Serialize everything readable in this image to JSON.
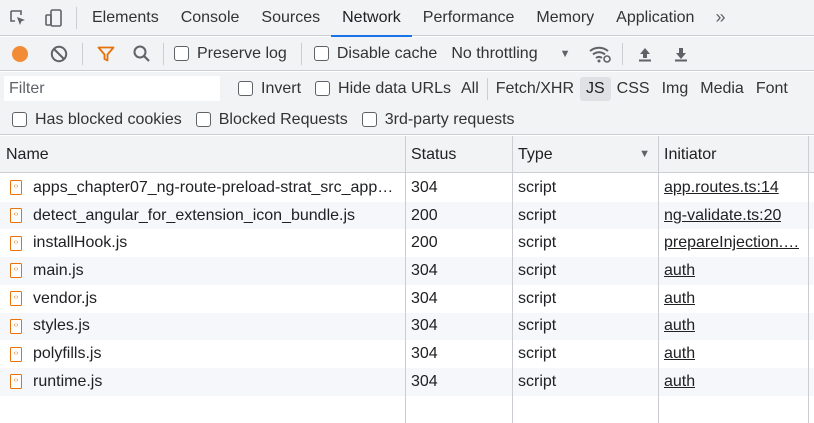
{
  "tabs": {
    "items": [
      "Elements",
      "Console",
      "Sources",
      "Network",
      "Performance",
      "Memory",
      "Application"
    ],
    "active": "Network",
    "more": "»"
  },
  "toolbar": {
    "record_color": "#f28b36",
    "preserve_log": "Preserve log",
    "disable_cache": "Disable cache",
    "throttling": "No throttling",
    "throttling_arrow": "▼"
  },
  "filter": {
    "placeholder": "Filter",
    "invert": "Invert",
    "hide_data_urls": "Hide data URLs",
    "types": [
      "All",
      "Fetch/XHR",
      "JS",
      "CSS",
      "Img",
      "Media",
      "Font"
    ],
    "active_type": "JS",
    "has_blocked_cookies": "Has blocked cookies",
    "blocked_requests": "Blocked Requests",
    "third_party": "3rd-party requests"
  },
  "table": {
    "columns": [
      "Name",
      "Status",
      "Type",
      "Initiator"
    ],
    "sort_arrow": "▼",
    "rows": [
      {
        "name": "apps_chapter07_ng-route-preload-strat_src_app…",
        "status": "304",
        "type": "script",
        "initiator": "app.routes.ts:14"
      },
      {
        "name": "detect_angular_for_extension_icon_bundle.js",
        "status": "200",
        "type": "script",
        "initiator": "ng-validate.ts:20"
      },
      {
        "name": "installHook.js",
        "status": "200",
        "type": "script",
        "initiator": "prepareInjection.…"
      },
      {
        "name": "main.js",
        "status": "304",
        "type": "script",
        "initiator": "auth"
      },
      {
        "name": "vendor.js",
        "status": "304",
        "type": "script",
        "initiator": "auth"
      },
      {
        "name": "styles.js",
        "status": "304",
        "type": "script",
        "initiator": "auth"
      },
      {
        "name": "polyfills.js",
        "status": "304",
        "type": "script",
        "initiator": "auth"
      },
      {
        "name": "runtime.js",
        "status": "304",
        "type": "script",
        "initiator": "auth"
      }
    ]
  }
}
